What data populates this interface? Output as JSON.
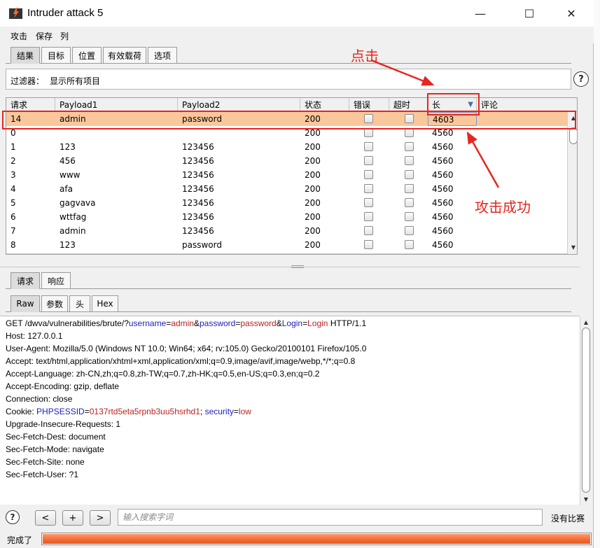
{
  "window": {
    "title": "Intruder attack 5",
    "minimize": "—",
    "maximize": "☐",
    "close": "✕"
  },
  "menu": [
    "攻击",
    "保存",
    "列"
  ],
  "main_tabs": [
    "结果",
    "目标",
    "位置",
    "有效载荷",
    "选项"
  ],
  "filter": {
    "label": "过滤器：",
    "value": "显示所有项目"
  },
  "help": "?",
  "columns": [
    "请求",
    "Payload1",
    "Payload2",
    "状态",
    "错误",
    "超时",
    "长",
    "评论"
  ],
  "sort_indicator": "▼",
  "rows": [
    {
      "req": "14",
      "p1": "admin",
      "p2": "password",
      "status": "200",
      "len": "4603",
      "selected": true
    },
    {
      "req": "0",
      "p1": "",
      "p2": "",
      "status": "200",
      "len": "4560"
    },
    {
      "req": "1",
      "p1": "123",
      "p2": "123456",
      "status": "200",
      "len": "4560"
    },
    {
      "req": "2",
      "p1": "456",
      "p2": "123456",
      "status": "200",
      "len": "4560"
    },
    {
      "req": "3",
      "p1": "www",
      "p2": "123456",
      "status": "200",
      "len": "4560"
    },
    {
      "req": "4",
      "p1": "afa",
      "p2": "123456",
      "status": "200",
      "len": "4560"
    },
    {
      "req": "5",
      "p1": "gagvava",
      "p2": "123456",
      "status": "200",
      "len": "4560"
    },
    {
      "req": "6",
      "p1": "wttfag",
      "p2": "123456",
      "status": "200",
      "len": "4560"
    },
    {
      "req": "7",
      "p1": "admin",
      "p2": "123456",
      "status": "200",
      "len": "4560"
    },
    {
      "req": "8",
      "p1": "123",
      "p2": "password",
      "status": "200",
      "len": "4560"
    }
  ],
  "annotations": {
    "click": "点击",
    "success": "攻击成功"
  },
  "detail_tabs": [
    "请求",
    "响应"
  ],
  "view_tabs": [
    "Raw",
    "参数",
    "头",
    "Hex"
  ],
  "request": {
    "line1": {
      "prefix": "GET /dwva/vulnerabilities/brute/?",
      "k1": "username",
      "eq": "=",
      "v1": "admin",
      "amp": "&",
      "k2": "password",
      "v2": "password",
      "k3": "Login",
      "v3": "Login",
      "suffix": " HTTP/1.1"
    },
    "host": "Host: 127.0.0.1",
    "ua": "User-Agent: Mozilla/5.0 (Windows NT 10.0; Win64; x64; rv:105.0) Gecko/20100101 Firefox/105.0",
    "accept": "Accept: text/html,application/xhtml+xml,application/xml;q=0.9,image/avif,image/webp,*/*;q=0.8",
    "lang": "Accept-Language: zh-CN,zh;q=0.8,zh-TW;q=0.7,zh-HK;q=0.5,en-US;q=0.3,en;q=0.2",
    "enc": "Accept-Encoding: gzip, deflate",
    "conn": "Connection: close",
    "cookie": {
      "prefix": "Cookie: ",
      "k1": "PHPSESSID",
      "eq": "=",
      "v1": "0137rtd5eta5rpnb3uu5hsrhd1",
      "sep": "; ",
      "k2": "security",
      "v2": "low"
    },
    "upgrade": "Upgrade-Insecure-Requests: 1",
    "dest": "Sec-Fetch-Dest: document",
    "mode": "Sec-Fetch-Mode: navigate",
    "site": "Sec-Fetch-Site: none",
    "user": "Sec-Fetch-User: ?1"
  },
  "search": {
    "prev": "<",
    "add": "+",
    "next": ">",
    "placeholder": "输入搜索字词",
    "matches": "没有比赛"
  },
  "status": {
    "text": "完成了",
    "progress": 1.0
  },
  "colors": {
    "highlight": "#f9c79b",
    "annotation": "#e8251e",
    "progress": "#f26a33"
  }
}
